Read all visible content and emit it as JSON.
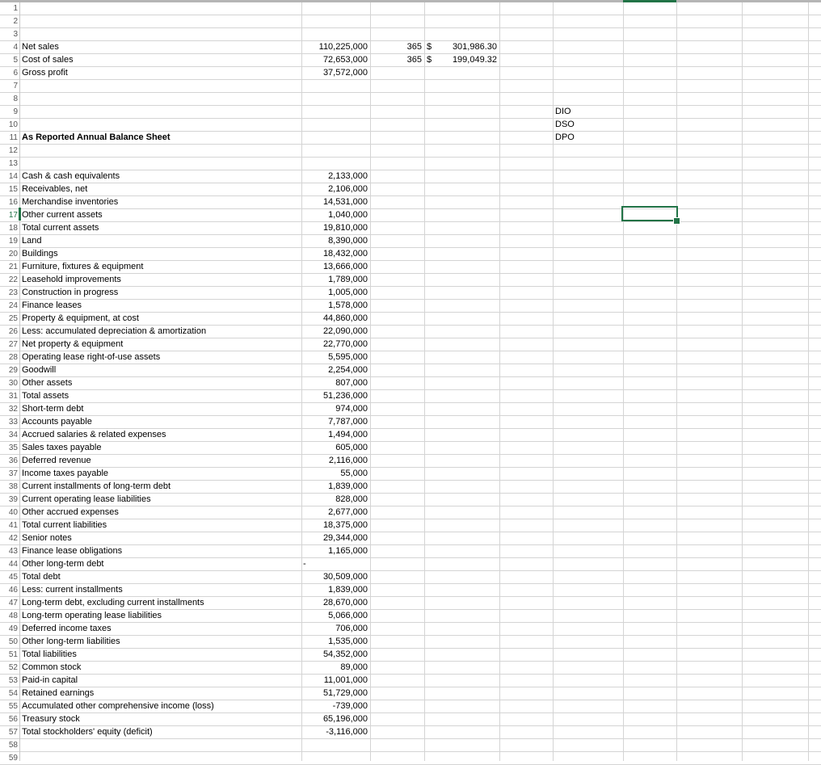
{
  "sheet": {
    "selected_cell": {
      "column": "G",
      "row": 17
    },
    "accent_color": "#217346",
    "row_numbers": [
      "1",
      "2",
      "3",
      "4",
      "5",
      "6",
      "7",
      "8",
      "9",
      "10",
      "11",
      "12",
      "13",
      "14",
      "15",
      "16",
      "17",
      "18",
      "19",
      "20",
      "21",
      "22",
      "23",
      "24",
      "25",
      "26",
      "27",
      "28",
      "29",
      "30",
      "31",
      "32",
      "33",
      "34",
      "35",
      "36",
      "37",
      "38",
      "39",
      "40",
      "41",
      "42",
      "43",
      "44",
      "45",
      "46",
      "47",
      "48",
      "49",
      "50",
      "51",
      "52",
      "53",
      "54",
      "55",
      "56",
      "57",
      "58",
      "59"
    ]
  },
  "income": {
    "net_sales": {
      "label": "Net sales",
      "value": "110,225,000",
      "days": "365",
      "currency": "$",
      "per_day": "301,986.30"
    },
    "cost_of_sales": {
      "label": "Cost of sales",
      "value": "72,653,000",
      "days": "365",
      "currency": "$",
      "per_day": "199,049.32"
    },
    "gross_profit": {
      "label": "Gross profit",
      "value": "37,572,000"
    }
  },
  "ratios": {
    "dio": "DIO",
    "dso": "DSO",
    "dpo": "DPO"
  },
  "balance_sheet": {
    "title": "As Reported Annual Balance Sheet",
    "items": [
      {
        "label": "Cash & cash equivalents",
        "value": "2,133,000"
      },
      {
        "label": "Receivables, net",
        "value": "2,106,000"
      },
      {
        "label": "Merchandise inventories",
        "value": "14,531,000"
      },
      {
        "label": "Other current assets",
        "value": "1,040,000"
      },
      {
        "label": "Total current assets",
        "value": "19,810,000"
      },
      {
        "label": "Land",
        "value": "8,390,000"
      },
      {
        "label": "Buildings",
        "value": "18,432,000"
      },
      {
        "label": "Furniture, fixtures & equipment",
        "value": "13,666,000"
      },
      {
        "label": "Leasehold improvements",
        "value": "1,789,000"
      },
      {
        "label": "Construction in progress",
        "value": "1,005,000"
      },
      {
        "label": "Finance leases",
        "value": "1,578,000"
      },
      {
        "label": "Property & equipment, at cost",
        "value": "44,860,000"
      },
      {
        "label": "Less: accumulated depreciation & amortization",
        "value": "22,090,000"
      },
      {
        "label": "Net property & equipment",
        "value": "22,770,000"
      },
      {
        "label": "Operating lease right-of-use assets",
        "value": "5,595,000"
      },
      {
        "label": "Goodwill",
        "value": "2,254,000"
      },
      {
        "label": "Other assets",
        "value": "807,000"
      },
      {
        "label": "Total assets",
        "value": "51,236,000"
      },
      {
        "label": "Short-term debt",
        "value": "974,000"
      },
      {
        "label": "Accounts payable",
        "value": "7,787,000"
      },
      {
        "label": "Accrued salaries & related expenses",
        "value": "1,494,000"
      },
      {
        "label": "Sales taxes payable",
        "value": "605,000"
      },
      {
        "label": "Deferred revenue",
        "value": "2,116,000"
      },
      {
        "label": "Income taxes payable",
        "value": "55,000"
      },
      {
        "label": "Current installments of long-term debt",
        "value": "1,839,000"
      },
      {
        "label": "Current operating lease liabilities",
        "value": "828,000"
      },
      {
        "label": "Other accrued expenses",
        "value": "2,677,000"
      },
      {
        "label": "Total current liabilities",
        "value": "18,375,000"
      },
      {
        "label": "Senior notes",
        "value": "29,344,000"
      },
      {
        "label": "Finance lease obligations",
        "value": "1,165,000"
      },
      {
        "label": "Other long-term debt",
        "value": "-"
      },
      {
        "label": "Total debt",
        "value": "30,509,000"
      },
      {
        "label": "Less: current installments",
        "value": "1,839,000"
      },
      {
        "label": "Long-term debt, excluding current installments",
        "value": "28,670,000"
      },
      {
        "label": "Long-term operating lease liabilities",
        "value": "5,066,000"
      },
      {
        "label": "Deferred income taxes",
        "value": "706,000"
      },
      {
        "label": "Other long-term liabilities",
        "value": "1,535,000"
      },
      {
        "label": "Total liabilities",
        "value": "54,352,000"
      },
      {
        "label": "Common stock",
        "value": "89,000"
      },
      {
        "label": "Paid-in capital",
        "value": "11,001,000"
      },
      {
        "label": "Retained earnings",
        "value": "51,729,000"
      },
      {
        "label": "Accumulated other comprehensive income (loss)",
        "value": "-739,000"
      },
      {
        "label": "Treasury stock",
        "value": "65,196,000"
      },
      {
        "label": "Total stockholders' equity (deficit)",
        "value": "-3,116,000"
      }
    ]
  }
}
